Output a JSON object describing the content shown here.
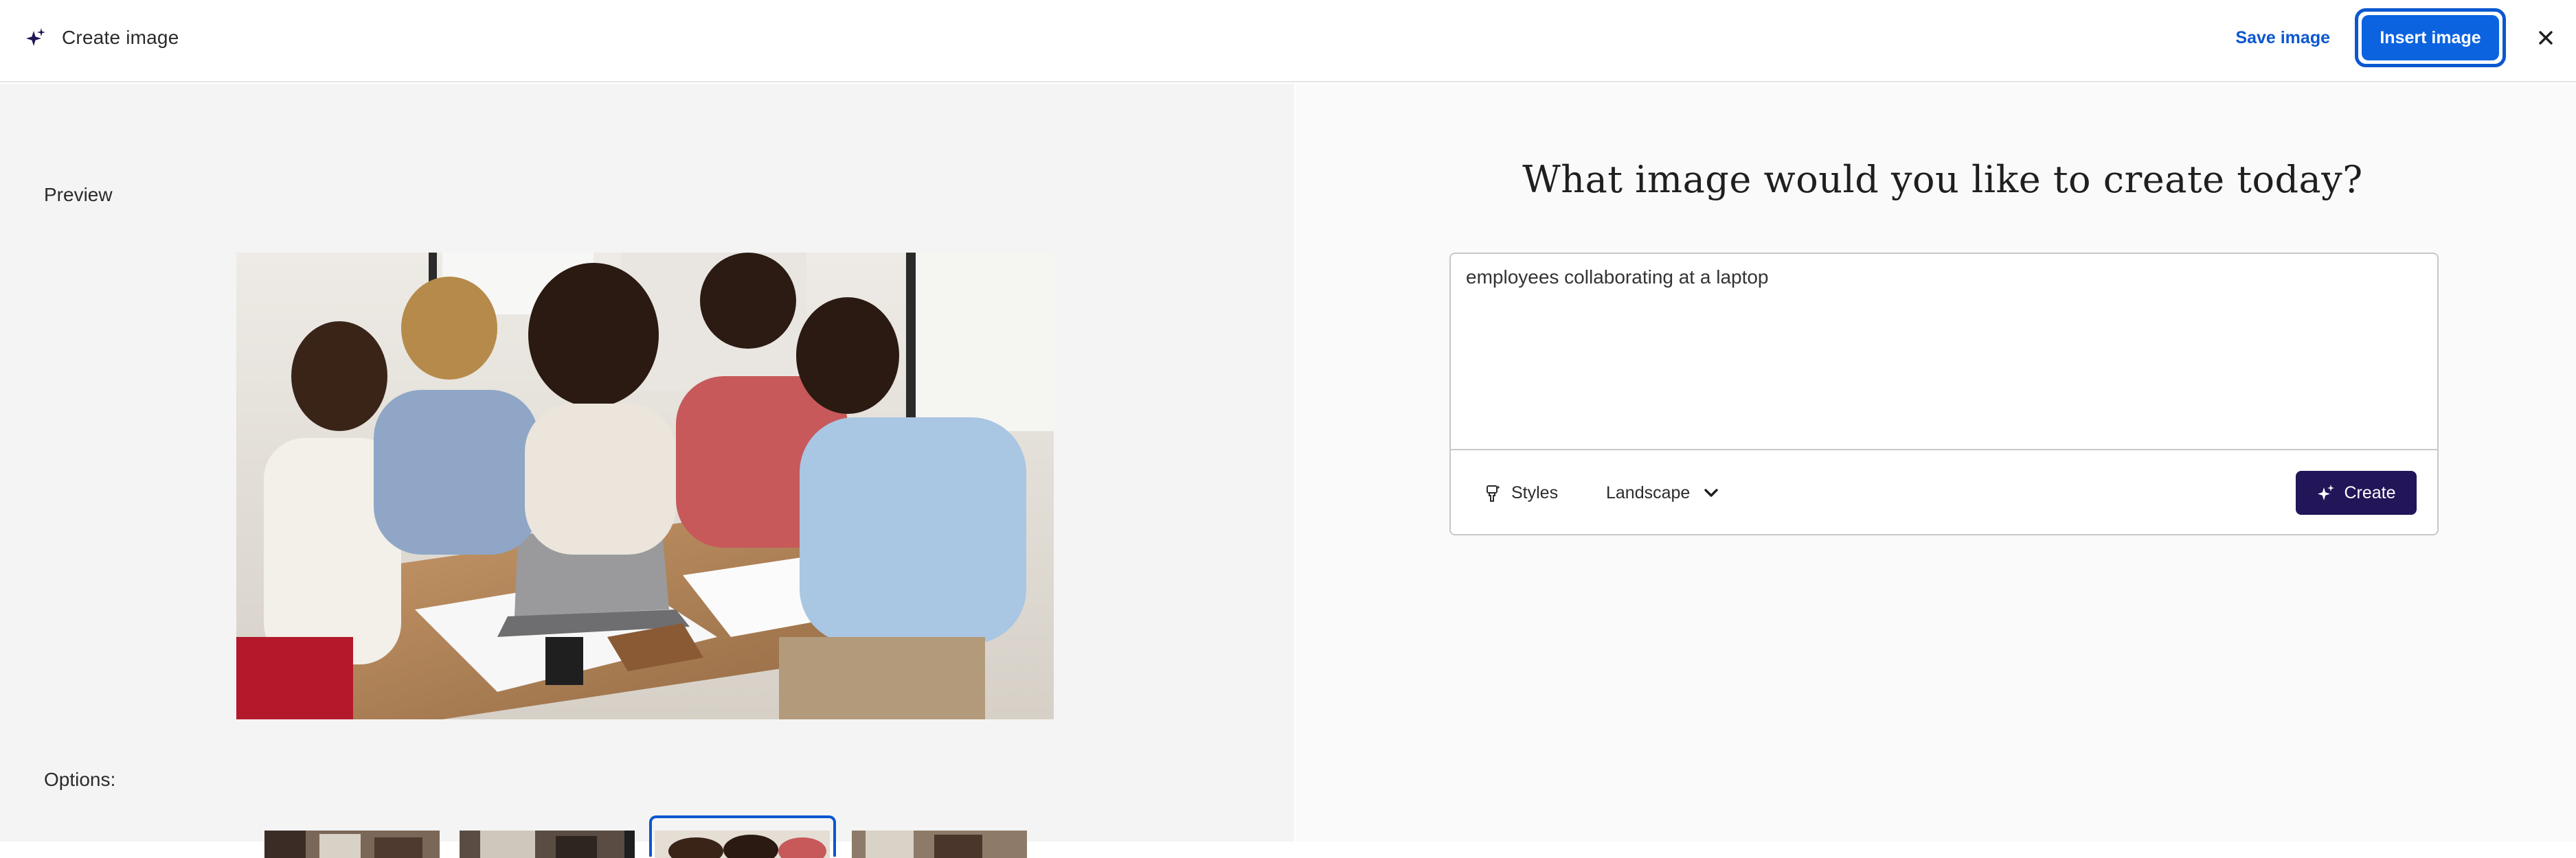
{
  "header": {
    "title": "Create image",
    "title_icon": "sparkle-icon",
    "save_label": "Save image",
    "insert_label": "Insert image",
    "close_icon": "close-icon"
  },
  "left_panel": {
    "preview_label": "Preview",
    "preview_image_description_icon": "generated-image",
    "options_label": "Options:",
    "options": [
      {
        "selected": false
      },
      {
        "selected": false
      },
      {
        "selected": true
      },
      {
        "selected": false
      }
    ]
  },
  "right_panel": {
    "heading": "What image would you like to create today?",
    "prompt_value": "employees collaborating at a laptop",
    "styles_label": "Styles",
    "styles_icon": "brush-icon",
    "aspect_label": "Landscape",
    "aspect_icon": "chevron-down-icon",
    "create_label": "Create",
    "create_icon": "sparkle-icon"
  },
  "colors": {
    "accent_blue": "#0b57d0",
    "insert_button": "#0b63e0",
    "create_button": "#221558",
    "left_bg": "#f4f4f4",
    "right_bg": "#fafafa"
  }
}
